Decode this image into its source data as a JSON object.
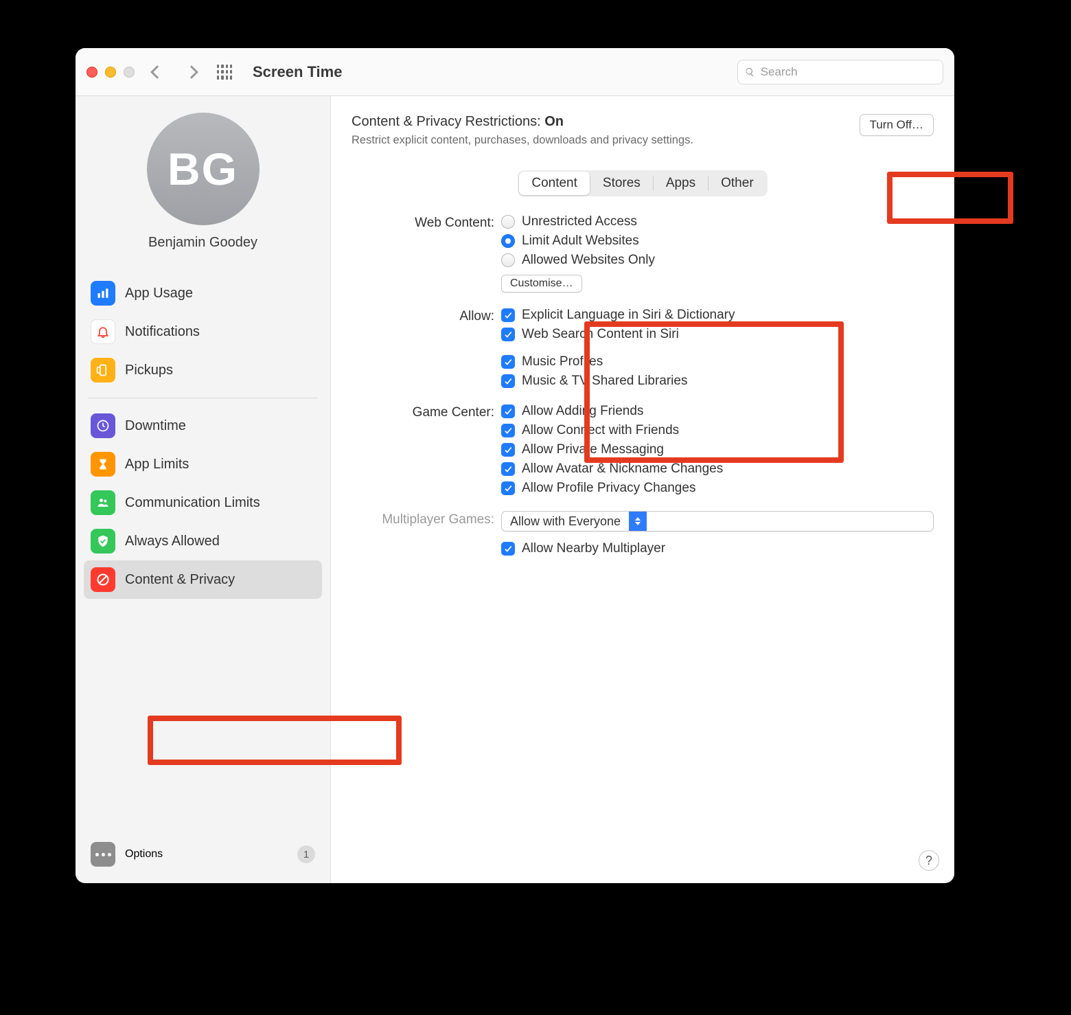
{
  "window": {
    "title": "Screen Time"
  },
  "search": {
    "placeholder": "Search",
    "value": ""
  },
  "profile": {
    "initials": "BG",
    "name": "Benjamin Goodey"
  },
  "sidebar": {
    "items": [
      {
        "label": "App Usage"
      },
      {
        "label": "Notifications"
      },
      {
        "label": "Pickups"
      }
    ],
    "items2": [
      {
        "label": "Downtime"
      },
      {
        "label": "App Limits"
      },
      {
        "label": "Communication Limits"
      },
      {
        "label": "Always Allowed"
      },
      {
        "label": "Content & Privacy"
      }
    ],
    "options_label": "Options",
    "options_badge": "1"
  },
  "main": {
    "heading_prefix": "Content & Privacy Restrictions: ",
    "heading_state": "On",
    "subtitle": "Restrict explicit content, purchases, downloads and privacy settings.",
    "turnoff_label": "Turn Off…",
    "tabs": [
      "Content",
      "Stores",
      "Apps",
      "Other"
    ],
    "active_tab": 0,
    "web_content": {
      "label": "Web Content:",
      "options": [
        "Unrestricted Access",
        "Limit Adult Websites",
        "Allowed Websites Only"
      ],
      "selected": 1,
      "customise_label": "Customise…"
    },
    "allow": {
      "label": "Allow:",
      "items": [
        {
          "label": "Explicit Language in Siri & Dictionary",
          "checked": true
        },
        {
          "label": "Web Search Content in Siri",
          "checked": true
        }
      ],
      "items2": [
        {
          "label": "Music Profiles",
          "checked": true
        },
        {
          "label": "Music & TV Shared Libraries",
          "checked": true
        }
      ]
    },
    "gamecenter": {
      "label": "Game Center:",
      "items": [
        {
          "label": "Allow Adding Friends",
          "checked": true
        },
        {
          "label": "Allow Connect with Friends",
          "checked": true
        },
        {
          "label": "Allow Private Messaging",
          "checked": true
        },
        {
          "label": "Allow Avatar & Nickname Changes",
          "checked": true
        },
        {
          "label": "Allow Profile Privacy Changes",
          "checked": true
        }
      ]
    },
    "multiplayer": {
      "label": "Multiplayer Games:",
      "select_value": "Allow with Everyone",
      "nearby": {
        "label": "Allow Nearby Multiplayer",
        "checked": true
      }
    },
    "help_label": "?"
  }
}
